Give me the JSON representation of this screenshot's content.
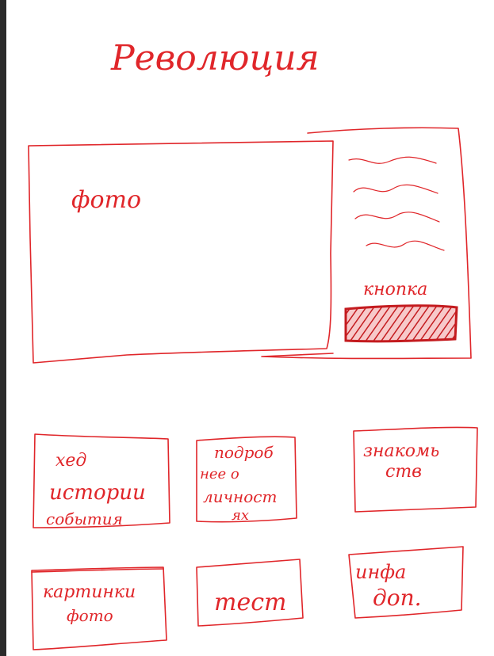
{
  "title": "Революция",
  "hero": {
    "photo_label": "фото",
    "button_label": "кнопка"
  },
  "cards_row1": [
    {
      "lines": [
        "хед",
        "истории",
        "события"
      ]
    },
    {
      "lines": [
        "подроб",
        "нее о",
        "личност",
        "ях"
      ]
    },
    {
      "lines": [
        "знакомь",
        "ств"
      ]
    }
  ],
  "cards_row2": [
    {
      "lines": [
        "картинки",
        "фото"
      ]
    },
    {
      "lines": [
        "тест"
      ]
    },
    {
      "lines": [
        "инфа",
        "доп."
      ]
    }
  ],
  "colors": {
    "ink": "#e0262a",
    "background": "#ffffff",
    "edge": "#2b2b2b"
  }
}
